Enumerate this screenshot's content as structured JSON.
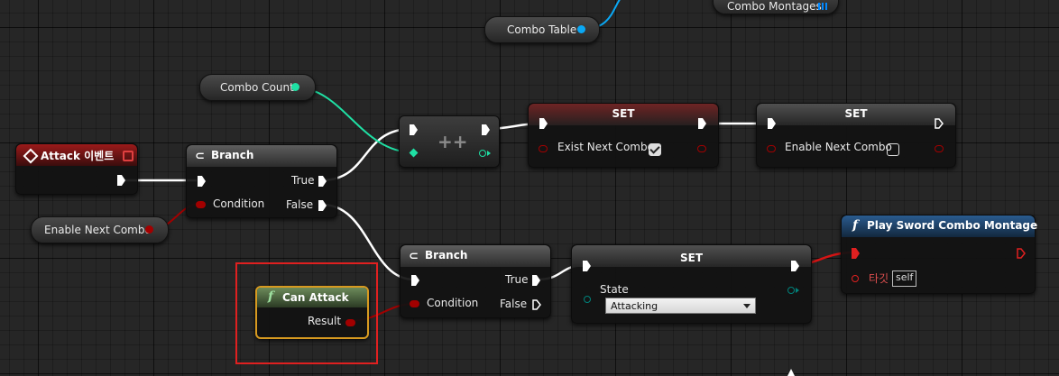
{
  "colors": {
    "exec": "#ffffff",
    "bool_pin": "#a20000",
    "int_pin": "#1fe0a4",
    "struct_pin": "#0aa8f5",
    "object_pin": "#0088ff",
    "enum_pin": "#00827b",
    "highlight": "#e02020"
  },
  "nodes": {
    "combo_table": {
      "label": "Combo Table"
    },
    "combo_montages": {
      "label": "Combo Montages"
    },
    "combo_count": {
      "label": "Combo Count"
    },
    "attack_event": {
      "title": "Attack 이벤트",
      "icon": "event-diamond-icon"
    },
    "enable_next_combo_get": {
      "label": "Enable Next Combo"
    },
    "branch1": {
      "title": "Branch",
      "condition": "Condition",
      "true": "True",
      "false": "False"
    },
    "increment": {
      "symbol": "++"
    },
    "set1": {
      "title": "SET",
      "var": "Exist Next Combo",
      "checked": true
    },
    "set2": {
      "title": "SET",
      "var": "Enable Next Combo",
      "checked": false
    },
    "can_attack": {
      "title": "Can Attack",
      "icon": "function-icon",
      "result": "Result"
    },
    "branch2": {
      "title": "Branch",
      "condition": "Condition",
      "true": "True",
      "false": "False"
    },
    "set_state": {
      "title": "SET",
      "var": "State",
      "value": "Attacking"
    },
    "play_montage": {
      "title": "Play Sword Combo Montage",
      "icon": "function-icon",
      "target": "타깃",
      "target_value": "self"
    }
  }
}
